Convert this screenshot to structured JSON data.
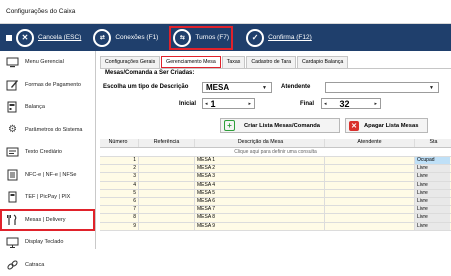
{
  "window": {
    "title": "Configurações do Caixa"
  },
  "toolbar": {
    "cancel": "Cancela (ESC)",
    "connections": "Conexões (F1)",
    "shifts": "Turnos (F7)",
    "confirm": "Confirma (F12)"
  },
  "sidebar": {
    "items": [
      {
        "label": "Menu Gerencial",
        "icon": "monitor-icon"
      },
      {
        "label": "Formas de Pagamento",
        "icon": "edit-icon"
      },
      {
        "label": "Balança",
        "icon": "scale-icon"
      },
      {
        "label": "Parâmetros do Sistema",
        "icon": "gears-icon"
      },
      {
        "label": "Texto Crediário",
        "icon": "text-icon"
      },
      {
        "label": "NFC-e | NF-e | NFSe",
        "icon": "document-icon"
      },
      {
        "label": "TEF | PicPay | PIX",
        "icon": "card-icon"
      },
      {
        "label": "Mesas | Delivery",
        "icon": "cutlery-icon"
      },
      {
        "label": "Display Teclado",
        "icon": "display-icon"
      },
      {
        "label": "Catraca",
        "icon": "link-icon"
      }
    ]
  },
  "tabs": [
    "Configurações Gerais",
    "Gerenciamento Mesa",
    "Taxas",
    "Cadastro de Tara",
    "Cardapio Balança"
  ],
  "panel": {
    "section_title": "Mesas/Comanda a Ser Criadas:",
    "type_label": "Escolha um tipo de Descrição",
    "type_value": "MESA",
    "attendant_label": "Atendente",
    "attendant_value": "",
    "start_label": "Inicial",
    "start_value": "1",
    "end_label": "Final",
    "end_value": "32",
    "create_button": "Criar Lista Mesas/Comanda",
    "delete_button": "Apagar Lista Mesas"
  },
  "grid": {
    "columns": [
      "Número",
      "Referência",
      "Descrição da Mesa",
      "Atendente",
      "Sta"
    ],
    "filter_hint": "Clique aqui para definir uma consulta",
    "rows": [
      {
        "num": "1",
        "ref": "",
        "desc": "MESA 1",
        "att": "",
        "status": "Ocupad"
      },
      {
        "num": "2",
        "ref": "",
        "desc": "MESA 2",
        "att": "",
        "status": "Livre"
      },
      {
        "num": "3",
        "ref": "",
        "desc": "MESA 3",
        "att": "",
        "status": "Livre"
      },
      {
        "num": "4",
        "ref": "",
        "desc": "MESA 4",
        "att": "",
        "status": "Livre"
      },
      {
        "num": "5",
        "ref": "",
        "desc": "MESA 5",
        "att": "",
        "status": "Livre"
      },
      {
        "num": "6",
        "ref": "",
        "desc": "MESA 6",
        "att": "",
        "status": "Livre"
      },
      {
        "num": "7",
        "ref": "",
        "desc": "MESA 7",
        "att": "",
        "status": "Livre"
      },
      {
        "num": "8",
        "ref": "",
        "desc": "MESA 8",
        "att": "",
        "status": "Livre"
      },
      {
        "num": "9",
        "ref": "",
        "desc": "MESA 9",
        "att": "",
        "status": "Livre"
      }
    ]
  },
  "colors": {
    "toolbar": "#1f3f6c",
    "highlight": "#e0222b",
    "row_yellow": "#fffbe6",
    "create_icon": "#2e9e3a",
    "delete_icon": "#d9302c"
  }
}
